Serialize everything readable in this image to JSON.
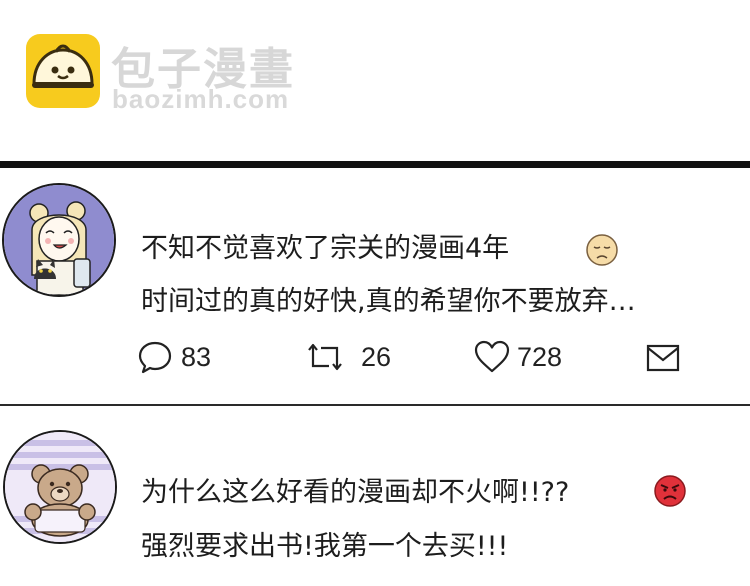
{
  "header": {
    "brand_name": "包子漫畫",
    "brand_url": "baozimh.com",
    "logo_icon": "bun-logo-icon",
    "logo_color": "#F7CB1E"
  },
  "comments": [
    {
      "avatar_icon": "girl-with-cat-avatar",
      "lines": [
        "不知不觉喜欢了宗关的漫画4年",
        "时间过的真的好快,真的希望你不要放弃…"
      ],
      "emoji_icon": "sad-face-icon",
      "actions": {
        "comment_count": "83",
        "retweet_count": "26",
        "like_count": "728"
      }
    },
    {
      "avatar_icon": "teddy-bear-avatar",
      "lines": [
        "为什么这么好看的漫画却不火啊!!??",
        "强烈要求出书!我第一个去买!!!"
      ],
      "emoji_icon": "angry-face-icon"
    }
  ],
  "colors": {
    "divider": "#111111",
    "avatar1_bg": "#8f8ccf",
    "avatar2_stripes": "#c9c0e6",
    "angry_emoji": "#e0313a",
    "sad_emoji": "#f6dca8"
  }
}
